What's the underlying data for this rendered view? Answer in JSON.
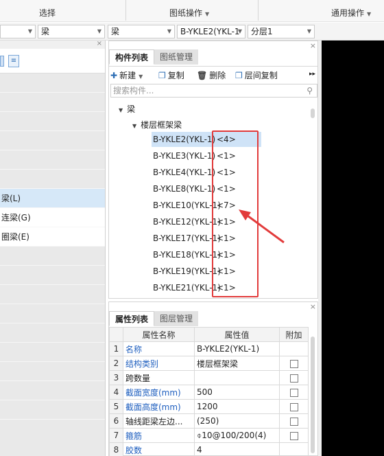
{
  "ribbon": {
    "groups": [
      "选择",
      "图纸操作",
      "通用操作"
    ]
  },
  "selectors": {
    "c1": "梁",
    "c2": "梁",
    "c3": "B-YKLE2(YKL-1",
    "c4": "分层1"
  },
  "left": {
    "items": [
      "梁(L)",
      "连梁(G)",
      "圈梁(E)"
    ]
  },
  "component_panel": {
    "tab_active": "构件列表",
    "tab_inactive": "图纸管理",
    "toolbar": {
      "new": "新建",
      "copy": "复制",
      "delete": "删除",
      "floor_copy": "层间复制"
    },
    "search_placeholder": "搜索构件...",
    "tree": {
      "root": "梁",
      "group": "楼层框架梁",
      "items": [
        {
          "name": "B-YKLE2(YKL-1)",
          "count": "<4>"
        },
        {
          "name": "B-YKLE3(YKL-1)",
          "count": "<1>"
        },
        {
          "name": "B-YKLE4(YKL-1)",
          "count": "<1>"
        },
        {
          "name": "B-YKLE8(YKL-1)",
          "count": "<1>"
        },
        {
          "name": "B-YKLE10(YKL-1)",
          "count": "<7>"
        },
        {
          "name": "B-YKLE12(YKL-1)",
          "count": "<1>"
        },
        {
          "name": "B-YKLE17(YKL-1)",
          "count": "<1>"
        },
        {
          "name": "B-YKLE18(YKL-1)",
          "count": "<1>"
        },
        {
          "name": "B-YKLE19(YKL-1)",
          "count": "<1>"
        },
        {
          "name": "B-YKLE21(YKL-1)",
          "count": "<1>"
        }
      ]
    }
  },
  "property_panel": {
    "tab_active": "属性列表",
    "tab_inactive": "图层管理",
    "headers": {
      "name": "属性名称",
      "value": "属性值",
      "extra": "附加"
    },
    "rows": [
      {
        "idx": "1",
        "name": "名称",
        "value": "B-YKLE2(YKL-1)"
      },
      {
        "idx": "2",
        "name": "结构类别",
        "value": "楼层框架梁"
      },
      {
        "idx": "3",
        "name": "跨数量",
        "value": ""
      },
      {
        "idx": "4",
        "name": "截面宽度(mm)",
        "value": "500"
      },
      {
        "idx": "5",
        "name": "截面高度(mm)",
        "value": "1200"
      },
      {
        "idx": "6",
        "name": "轴线距梁左边...",
        "value": "(250)"
      },
      {
        "idx": "7",
        "name": "箍筋",
        "value": "⌽10@100/200(4)"
      },
      {
        "idx": "8",
        "name": "胶数",
        "value": "4"
      }
    ]
  },
  "colors": {
    "annotation": "#e23b3b",
    "selection": "#cfe3f7",
    "link_blue": "#1f5fbf"
  }
}
